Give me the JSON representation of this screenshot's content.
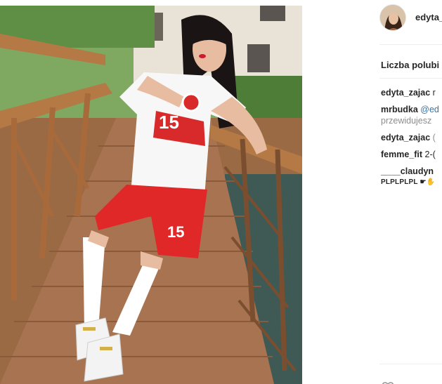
{
  "post": {
    "username": "edyta_",
    "likes_label": "Liczba polubi"
  },
  "comments": [
    {
      "user": "edyta_zajac",
      "text": "r"
    },
    {
      "user": "mrbudka",
      "mention": "@ed",
      "line2": "przewidujesz"
    },
    {
      "user": "edyta_zajac",
      "text": "("
    },
    {
      "user": "femme_fit",
      "text": "2-("
    },
    {
      "user": "____claudyn",
      "line2": "PLPLPLPL ☛✋"
    }
  ],
  "colors": {
    "username": "#262626",
    "mention": "#3f729b",
    "divider": "#efefef"
  },
  "icons": {
    "avatar": "profile-avatar",
    "heart": "heart-icon"
  }
}
